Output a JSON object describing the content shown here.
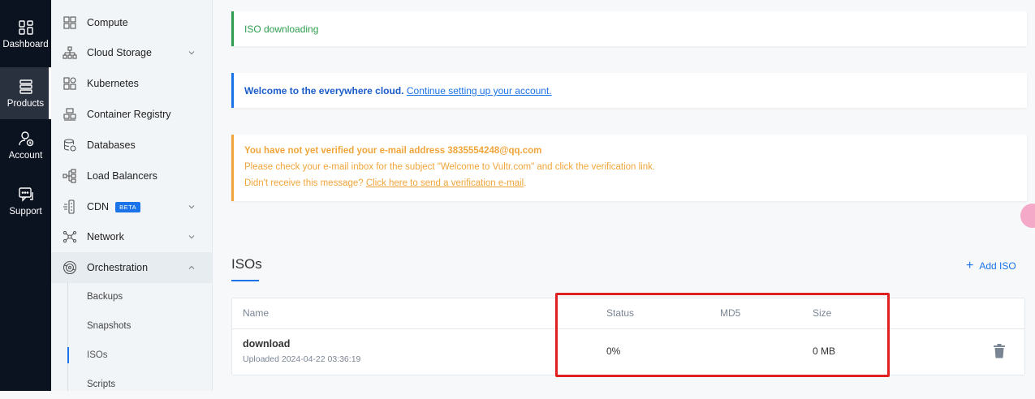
{
  "rail": {
    "items": [
      {
        "label": "Dashboard",
        "icon": "dashboard-icon"
      },
      {
        "label": "Products",
        "icon": "products-icon",
        "active": true
      },
      {
        "label": "Account",
        "icon": "account-icon"
      },
      {
        "label": "Support",
        "icon": "support-icon"
      }
    ]
  },
  "sidebar": {
    "items": [
      {
        "label": "Compute",
        "icon": "compute-icon"
      },
      {
        "label": "Cloud Storage",
        "icon": "cloud-storage-icon",
        "expandable": true
      },
      {
        "label": "Kubernetes",
        "icon": "kubernetes-icon"
      },
      {
        "label": "Container Registry",
        "icon": "container-registry-icon"
      },
      {
        "label": "Databases",
        "icon": "databases-icon"
      },
      {
        "label": "Load Balancers",
        "icon": "load-balancers-icon"
      },
      {
        "label": "CDN",
        "icon": "cdn-icon",
        "badge": "BETA",
        "expandable": true
      },
      {
        "label": "Network",
        "icon": "network-icon",
        "expandable": true
      },
      {
        "label": "Orchestration",
        "icon": "orchestration-icon",
        "expanded": true
      }
    ],
    "sub_items": [
      {
        "label": "Backups"
      },
      {
        "label": "Snapshots"
      },
      {
        "label": "ISOs",
        "active": true
      },
      {
        "label": "Scripts"
      }
    ]
  },
  "alerts": {
    "success": "ISO downloading",
    "info": {
      "bold": "Welcome to the everywhere cloud.",
      "link": "Continue setting up your account."
    },
    "warning": {
      "line1": "You have not yet verified your e-mail address 3835554248@qq.com",
      "line2": "Please check your e-mail inbox for the subject \"Welcome to Vultr.com\" and click the verification link.",
      "line3_prefix": "Didn't receive this message?",
      "line3_link": "Click here to send a verification e-mail",
      "line3_suffix": "."
    }
  },
  "isos": {
    "title": "ISOs",
    "add_label": "Add ISO",
    "columns": {
      "name": "Name",
      "status": "Status",
      "md5": "MD5",
      "size": "Size"
    },
    "rows": [
      {
        "name": "download",
        "uploaded": "Uploaded 2024-04-22 03:36:19",
        "status": "0%",
        "md5": "",
        "size": "0 MB"
      }
    ]
  },
  "colors": {
    "accent": "#1a73e8",
    "success": "#2e9d4e",
    "warning": "#f0a53a",
    "highlight": "#e02020",
    "rail_bg": "#0b1220"
  }
}
